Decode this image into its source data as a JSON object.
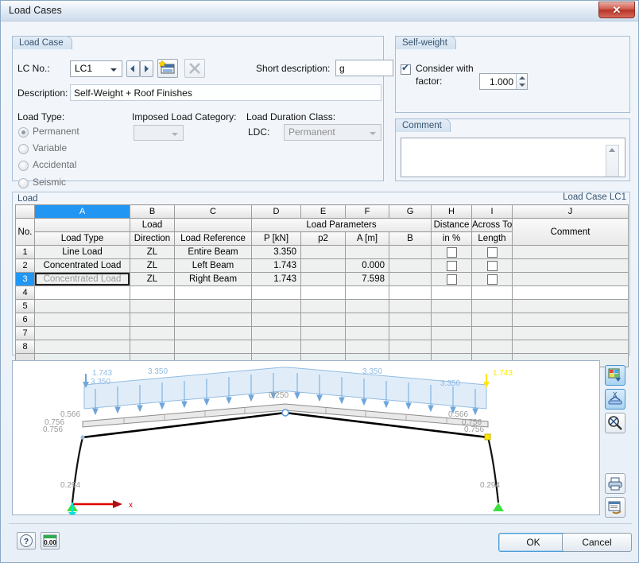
{
  "window": {
    "title": "Load Cases",
    "close_icon": "close-icon"
  },
  "load_case": {
    "group_title": "Load Case",
    "lc_no_label": "LC No.:",
    "lc_no_value": "LC1",
    "prev_icon": "prev-arrow-icon",
    "next_icon": "next-arrow-icon",
    "new_icon": "new-load-case-icon",
    "delete_icon": "delete-load-case-icon",
    "short_desc_label": "Short description:",
    "short_desc_value": "g",
    "description_label": "Description:",
    "description_value": "Self-Weight + Roof Finishes",
    "load_type_label": "Load Type:",
    "load_types": [
      {
        "label": "Permanent",
        "selected": true
      },
      {
        "label": "Variable",
        "selected": false
      },
      {
        "label": "Accidental",
        "selected": false
      },
      {
        "label": "Seismic",
        "selected": false
      }
    ],
    "imposed_label": "Imposed Load Category:",
    "imposed_value": "",
    "ldc_group_label": "Load Duration Class:",
    "ldc_label": "LDC:",
    "ldc_value": "Permanent"
  },
  "self_weight": {
    "group_title": "Self-weight",
    "checkbox_label_1": "Consider with",
    "checkbox_label_2": "factor:",
    "checked": true,
    "factor_value": "1.000"
  },
  "comment": {
    "group_title": "Comment",
    "value": "",
    "scroll_up_icon": "scroll-up-icon",
    "scroll_down_icon": "scroll-down-icon"
  },
  "load_table": {
    "group_title": "Load",
    "corner_label": "Load Case LC1",
    "column_letters": [
      "A",
      "B",
      "C",
      "D",
      "E",
      "F",
      "G",
      "H",
      "I",
      "J"
    ],
    "selected_column": "A",
    "group_headers": [
      {
        "label": "Load Parameters",
        "span": "D-G"
      }
    ],
    "headers_top": [
      "",
      "Load",
      "",
      "",
      "Load Parameters",
      "",
      "",
      "Distance",
      "Across Tot",
      ""
    ],
    "headers": [
      {
        "line1": "",
        "line2": "No."
      },
      {
        "line1": "",
        "line2": "Load Type"
      },
      {
        "line1": "Load",
        "line2": "Direction"
      },
      {
        "line1": "",
        "line2": "Load Reference"
      },
      {
        "line1": "",
        "line2": "P [kN]"
      },
      {
        "line1": "",
        "line2": "p2"
      },
      {
        "line1": "",
        "line2": "A [m]"
      },
      {
        "line1": "",
        "line2": "B"
      },
      {
        "line1": "Distance",
        "line2": "in %"
      },
      {
        "line1": "Across Tot",
        "line2": "Length"
      },
      {
        "line1": "",
        "line2": "Comment"
      }
    ],
    "rows": [
      {
        "no": "1",
        "load_type": "Line Load",
        "direction": "ZL",
        "reference": "Entire Beam",
        "p": "3.350",
        "p2": "",
        "a": "",
        "b": "",
        "dist_pct": false,
        "across": false,
        "comment": "",
        "state": "filled"
      },
      {
        "no": "2",
        "load_type": "Concentrated Load",
        "direction": "ZL",
        "reference": "Left Beam",
        "p": "1.743",
        "p2": "",
        "a": "0.000",
        "b": "",
        "dist_pct": false,
        "across": false,
        "comment": "",
        "state": "filled"
      },
      {
        "no": "3",
        "load_type": "Concentrated Load",
        "direction": "ZL",
        "reference": "Right Beam",
        "p": "1.743",
        "p2": "",
        "a": "7.598",
        "b": "",
        "dist_pct": false,
        "across": false,
        "comment": "",
        "state": "selected"
      },
      {
        "no": "4",
        "load_type": "",
        "direction": "",
        "reference": "",
        "p": "",
        "p2": "",
        "a": "",
        "b": "",
        "dist_pct": null,
        "across": null,
        "comment": "",
        "state": "empty-white"
      },
      {
        "no": "5",
        "load_type": "",
        "direction": "",
        "reference": "",
        "p": "",
        "p2": "",
        "a": "",
        "b": "",
        "dist_pct": null,
        "across": null,
        "comment": "",
        "state": "empty"
      },
      {
        "no": "6",
        "load_type": "",
        "direction": "",
        "reference": "",
        "p": "",
        "p2": "",
        "a": "",
        "b": "",
        "dist_pct": null,
        "across": null,
        "comment": "",
        "state": "empty"
      },
      {
        "no": "7",
        "load_type": "",
        "direction": "",
        "reference": "",
        "p": "",
        "p2": "",
        "a": "",
        "b": "",
        "dist_pct": null,
        "across": null,
        "comment": "",
        "state": "empty"
      },
      {
        "no": "8",
        "load_type": "",
        "direction": "",
        "reference": "",
        "p": "",
        "p2": "",
        "a": "",
        "b": "",
        "dist_pct": null,
        "across": null,
        "comment": "",
        "state": "empty"
      }
    ]
  },
  "graphic": {
    "labels": {
      "left_point_load": "1.743",
      "left_line_load": "3.350",
      "mid_line_load": "3.350",
      "right_line_load": "3.350",
      "right_point_load": "1.743",
      "ridge": "0.250",
      "left_member_a": "0.566",
      "left_member_b": "0.756",
      "left_member_c": "0.756",
      "right_member_a": "0.566",
      "right_member_b": "0.756",
      "right_member_c": "0.756",
      "left_column": "0.294",
      "right_column": "0.294",
      "axis_x": "x"
    },
    "colors": {
      "load_fill": "#cfe4f7",
      "load_stroke": "#5c9bd6",
      "load_text": "#7ab0e0",
      "selected": "#ffe800",
      "support": "#3ee03e",
      "axis_x": "#e00000",
      "axis_z": "#00e0e0"
    },
    "toolbar": [
      {
        "icon": "render-settings-icon",
        "active": true
      },
      {
        "icon": "show-values-icon",
        "active": true
      },
      {
        "icon": "find-object-icon",
        "active": false
      },
      {
        "icon": "print-icon",
        "active": false
      },
      {
        "icon": "printout-report-icon",
        "active": false
      }
    ]
  },
  "footer": {
    "help_icon": "help-icon",
    "units_icon": "units-and-decimal-places-icon",
    "ok_label": "OK",
    "cancel_label": "Cancel"
  }
}
